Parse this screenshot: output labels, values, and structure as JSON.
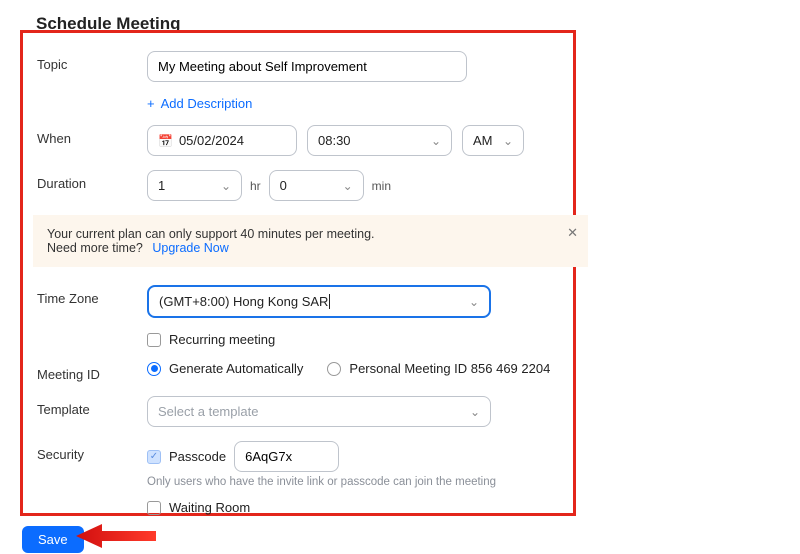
{
  "page_title": "Schedule Meeting",
  "topic": {
    "label": "Topic",
    "value": "My Meeting about Self Improvement",
    "add_description": "Add Description"
  },
  "when": {
    "label": "When",
    "date": "05/02/2024",
    "time": "08:30",
    "ampm": "AM"
  },
  "duration": {
    "label": "Duration",
    "hours": "1",
    "hr_unit": "hr",
    "minutes": "0",
    "min_unit": "min"
  },
  "banner": {
    "line1": "Your current plan can only support 40 minutes per meeting.",
    "line2": "Need more time?",
    "upgrade": "Upgrade Now"
  },
  "timezone": {
    "label": "Time Zone",
    "value": "(GMT+8:00) Hong Kong SAR"
  },
  "recurring": {
    "label": "Recurring meeting"
  },
  "meeting_id": {
    "label": "Meeting ID",
    "generate": "Generate Automatically",
    "personal": "Personal Meeting ID 856 469 2204"
  },
  "template": {
    "label": "Template",
    "placeholder": "Select a template"
  },
  "security": {
    "label": "Security",
    "passcode_label": "Passcode",
    "passcode_value": "6AqG7x",
    "passcode_hint": "Only users who have the invite link or passcode can join the meeting",
    "waiting_room": "Waiting Room"
  },
  "save": "Save"
}
